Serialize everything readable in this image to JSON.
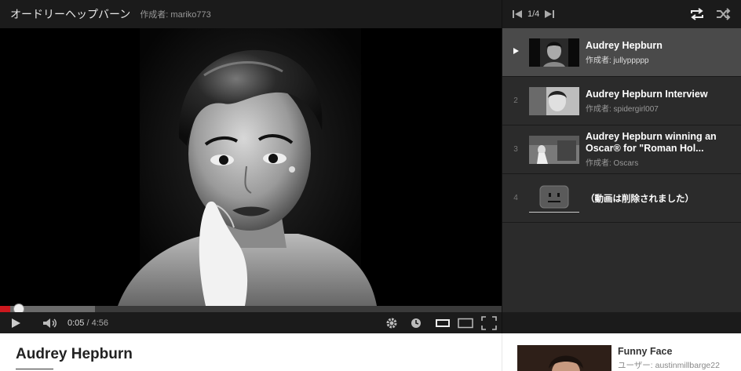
{
  "playlist": {
    "title": "オードリーヘップバーン",
    "author": "作成者: mariko773",
    "position": "1/4"
  },
  "player": {
    "current_time": "0:05",
    "separator": "/",
    "duration": "4:56",
    "progress_played": 0.02,
    "progress_buffered": 0.19
  },
  "items": [
    {
      "index": "",
      "title": "Audrey Hepburn",
      "author": "作成者: jullyppppp"
    },
    {
      "index": "2",
      "title": "Audrey Hepburn Interview",
      "author": "作成者: spidergirl007"
    },
    {
      "index": "3",
      "title": "Audrey Hepburn winning an Oscar® for \"Roman Hol...",
      "author": "作成者: Oscars"
    },
    {
      "index": "4",
      "title": "（動画は削除されました）"
    }
  ],
  "video": {
    "title": "Audrey Hepburn"
  },
  "recommended": {
    "title": "Funny Face",
    "user": "ユーザー: austinmillbarge22"
  },
  "colors": {
    "accent": "#cc181e",
    "panel": "#2b2b2b",
    "bar": "#1b1b1b"
  },
  "icons": [
    "previous-icon",
    "next-icon",
    "repeat-icon",
    "shuffle-icon",
    "play-icon",
    "volume-icon",
    "settings-icon",
    "watch-later-icon",
    "small-player-icon",
    "large-player-icon",
    "fullscreen-icon",
    "now-playing-icon",
    "deleted-video-icon"
  ]
}
